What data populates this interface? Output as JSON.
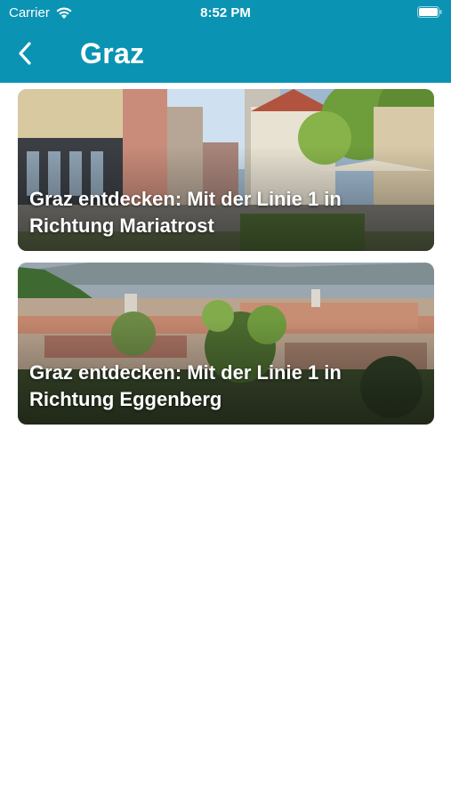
{
  "status_bar": {
    "carrier": "Carrier",
    "time": "8:52 PM",
    "wifi_icon": "wifi-icon",
    "battery_icon": "battery-icon"
  },
  "nav": {
    "back_icon": "chevron-left-icon",
    "title": "Graz",
    "color": "#0b93b4"
  },
  "cards": [
    {
      "title": "Graz entdecken: Mit der Linie 1 in Richtung Mariatrost"
    },
    {
      "title": "Graz entdecken: Mit der Linie 1 in Richtung Eggenberg"
    }
  ]
}
